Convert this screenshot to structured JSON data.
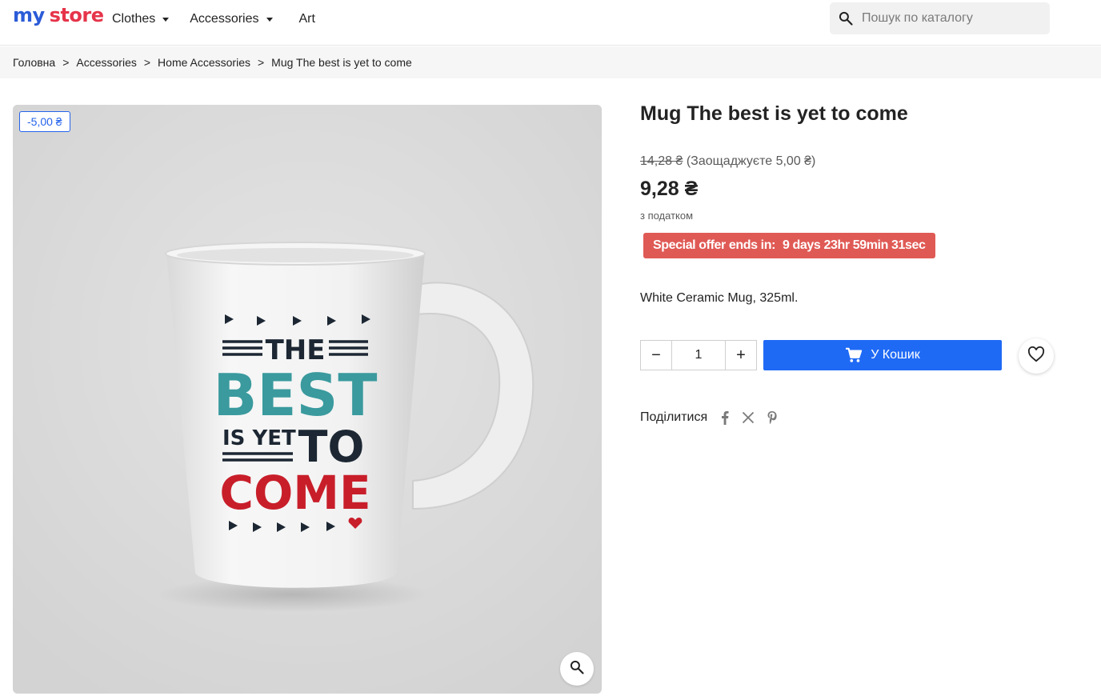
{
  "header": {
    "logo_part1": "my",
    "logo_part2": "store",
    "nav": [
      {
        "label": "Clothes",
        "has_dropdown": true
      },
      {
        "label": "Accessories",
        "has_dropdown": true
      },
      {
        "label": "Art",
        "has_dropdown": false
      }
    ],
    "search": {
      "placeholder": "Пошук по каталогу",
      "value": ""
    }
  },
  "breadcrumb": {
    "items": [
      "Головна",
      "Accessories",
      "Home Accessories",
      "Mug The best is yet to come"
    ],
    "separator": ">"
  },
  "product": {
    "discount_badge": "-5,00 ₴",
    "title": "Mug The best is yet to come",
    "old_price": "14,28 ₴",
    "savings": "(Заощаджуєте 5,00 ₴)",
    "price": "9,28 ₴",
    "tax_label": "з податком",
    "offer_label": "Special offer ends in:",
    "offer_countdown": "9 days 23hr 59min 31sec",
    "description": "White Ceramic Mug, 325ml.",
    "quantity": "1",
    "qty_minus": "−",
    "qty_plus": "+",
    "add_to_cart_label": "У Кошик",
    "share_label": "Поділитися",
    "image_text": {
      "line1": "THE",
      "line2": "BEST",
      "line3a": "IS YET",
      "line3b": "TO",
      "line4": "COME"
    }
  },
  "colors": {
    "accent": "#1f6af5",
    "offer_bg": "#e05a55",
    "badge": "#2563eb",
    "mug_teal": "#3a9a9e",
    "mug_red": "#c81e2a",
    "mug_dark": "#1c2733"
  },
  "icons": [
    "search-icon",
    "zoom-icon",
    "cart-icon",
    "heart-icon",
    "facebook-icon",
    "x-icon",
    "pinterest-icon",
    "caret-down-icon"
  ]
}
